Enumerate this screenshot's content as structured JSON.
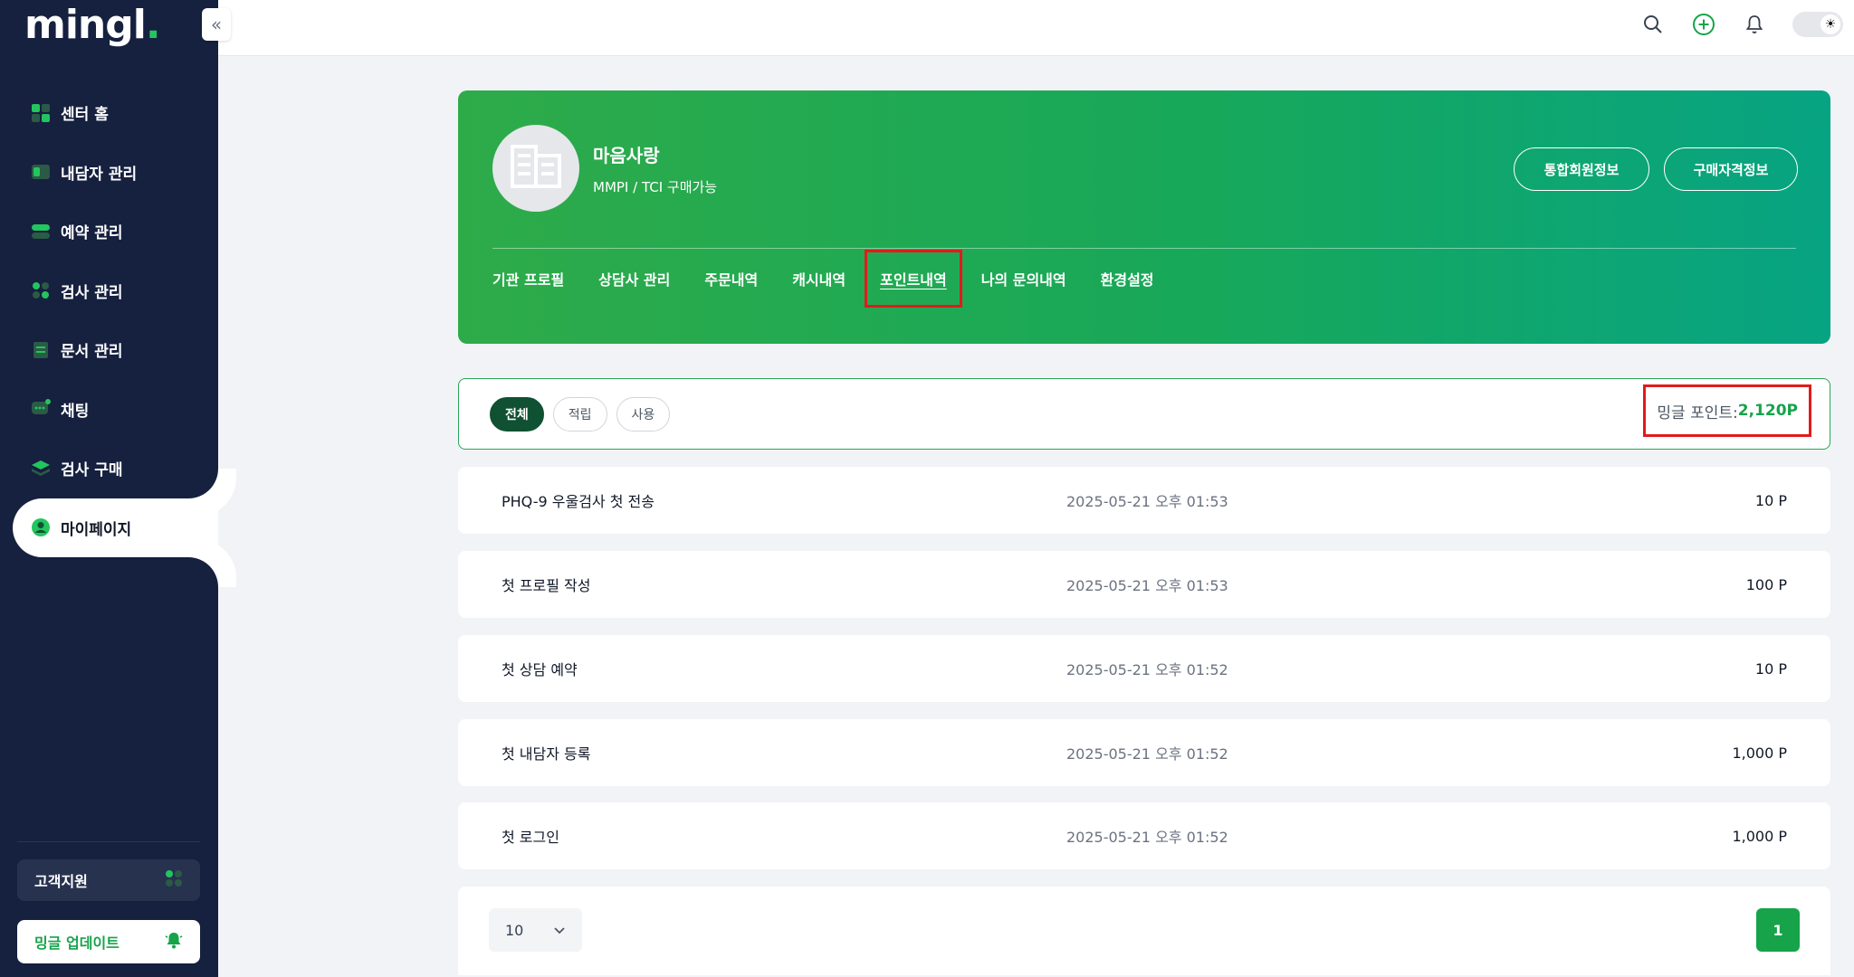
{
  "app": {
    "logo_text": "mingl",
    "logo_dot": "."
  },
  "sidebar": {
    "items": [
      {
        "label": "센터 홈",
        "icon": "dashboard-icon"
      },
      {
        "label": "내담자 관리",
        "icon": "client-icon"
      },
      {
        "label": "예약 관리",
        "icon": "reservation-icon"
      },
      {
        "label": "검사 관리",
        "icon": "test-icon"
      },
      {
        "label": "문서 관리",
        "icon": "document-icon"
      },
      {
        "label": "채팅",
        "icon": "chat-icon"
      },
      {
        "label": "검사 구매",
        "icon": "purchase-icon"
      },
      {
        "label": "마이페이지",
        "icon": "user-icon",
        "active": true
      }
    ],
    "support_label": "고객지원",
    "update_label": "밍글 업데이트"
  },
  "topbar": {
    "icons": [
      "search-icon",
      "add-circle-icon",
      "bell-icon",
      "theme-toggle"
    ]
  },
  "profile": {
    "name": "마음사랑",
    "subtitle": "MMPI / TCI 구매가능",
    "btn_member": "통합회원정보",
    "btn_qualification": "구매자격정보",
    "tabs": [
      "기관 프로필",
      "상담사 관리",
      "주문내역",
      "캐시내역",
      "포인트내역",
      "나의 문의내역",
      "환경설정"
    ],
    "active_tab": "포인트내역"
  },
  "filter": {
    "chips": [
      "전체",
      "적립",
      "사용"
    ],
    "active_chip": "전체",
    "points_label": "밍글 포인트:",
    "points_value": "2,120P"
  },
  "history": [
    {
      "title": "PHQ-9 우울검사 첫 전송",
      "date": "2025-05-21 오후 01:53",
      "points": "10 P"
    },
    {
      "title": "첫 프로필 작성",
      "date": "2025-05-21 오후 01:53",
      "points": "100 P"
    },
    {
      "title": "첫 상담 예약",
      "date": "2025-05-21 오후 01:52",
      "points": "10 P"
    },
    {
      "title": "첫 내담자 등록",
      "date": "2025-05-21 오후 01:52",
      "points": "1,000 P"
    },
    {
      "title": "첫 로그인",
      "date": "2025-05-21 오후 01:52",
      "points": "1,000 P"
    }
  ],
  "pagination": {
    "page_size": "10",
    "current_page": "1"
  },
  "colors": {
    "sidebar_bg": "#16203f",
    "accent": "#16a34a",
    "highlight": "#e01b1b"
  }
}
